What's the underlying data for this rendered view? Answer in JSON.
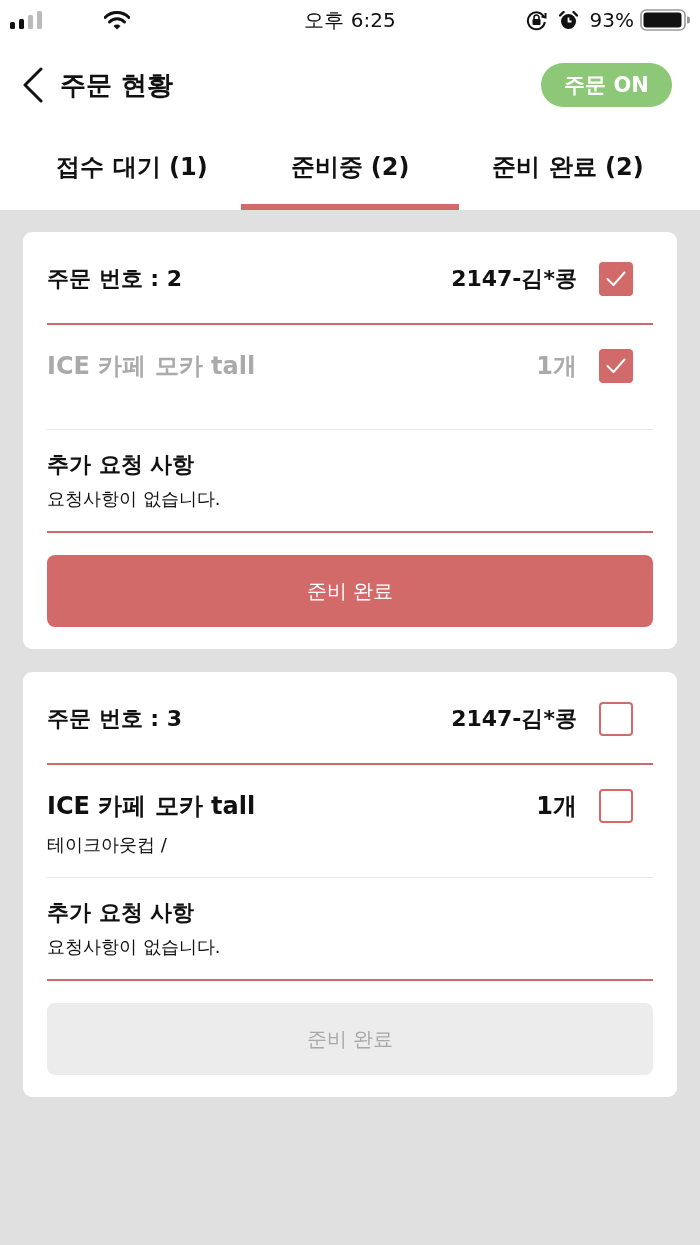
{
  "status_bar": {
    "time": "오후 6:25",
    "battery": "93%"
  },
  "header": {
    "title": "주문 현황",
    "order_toggle": {
      "label": "주문 ON",
      "on": true
    }
  },
  "tabs": [
    {
      "label": "접수 대기 (1)",
      "selected": false
    },
    {
      "label": "준비중 (2)",
      "selected": true
    },
    {
      "label": "준비 완료 (2)",
      "selected": false
    }
  ],
  "orders": [
    {
      "order_number": "주문 번호 : 2",
      "customer": "2147-김*콩",
      "checked": true,
      "items": [
        {
          "name": "ICE 카페 모카 tall",
          "quantity": "1개",
          "checked": true
        }
      ],
      "request_title": "추가 요청 사항",
      "request_text": "요청사항이 없습니다.",
      "button": {
        "label": "준비 완료",
        "disabled": false
      }
    },
    {
      "order_number": "주문 번호 : 3",
      "customer": "2147-김*콩",
      "checked": false,
      "items": [
        {
          "name": "ICE 카페 모카 tall",
          "quantity": "1개",
          "checked": false,
          "options": "테이크아웃컵 /"
        }
      ],
      "request_title": "추가 요청 사항",
      "request_text": "요청사항이 없습니다.",
      "button": {
        "label": "준비 완료",
        "disabled": true
      }
    }
  ]
}
